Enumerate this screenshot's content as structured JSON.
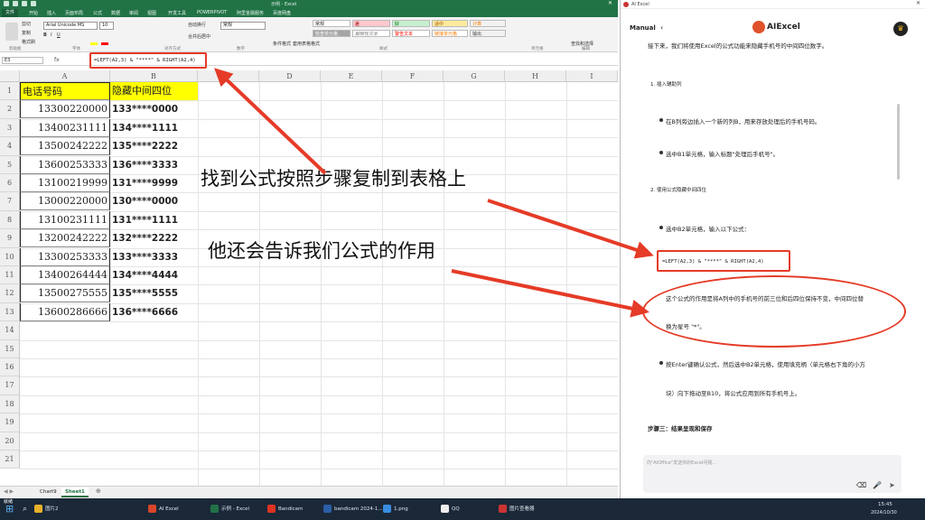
{
  "excel": {
    "window_title": "示例 - Excel",
    "tabs": [
      "文件",
      "开始",
      "插入",
      "页面布局",
      "公式",
      "数据",
      "审阅",
      "视图",
      "开发工具",
      "POWERPIVOT",
      "阿里金融服务",
      "百度网盘"
    ],
    "ribbon": {
      "cut": "剪切",
      "copy": "复制",
      "format_painter": "格式刷",
      "font": "Arial Unicode MS",
      "font_size": "10",
      "wrap": "自动换行",
      "merge": "合并后居中",
      "number_format": "常规",
      "cond_format": "条件格式",
      "table_format": "套用表格格式",
      "styles": [
        "常规",
        "差",
        "好",
        "适中",
        "计算",
        "检查单元格",
        "解释性文本",
        "警告文本",
        "链接单元格",
        "输出"
      ],
      "find_select": "查找和选择",
      "groups": [
        "剪贴板",
        "字体",
        "对齐方式",
        "数字",
        "样式",
        "单元格",
        "编辑"
      ]
    },
    "name_box": "E3",
    "formula_label": "fx",
    "formula": "=LEFT(A2,3) & \"****\" & RIGHT(A2,4)",
    "columns": [
      "A",
      "B",
      "C",
      "D",
      "E",
      "F",
      "G",
      "H",
      "I"
    ],
    "rows": [
      "1",
      "2",
      "3",
      "4",
      "5",
      "6",
      "7",
      "8",
      "9",
      "10",
      "11",
      "12",
      "13",
      "14",
      "15",
      "16",
      "17",
      "18",
      "19",
      "20",
      "21"
    ],
    "header_a": "电话号码",
    "header_b": "隐藏中间四位",
    "data": [
      [
        "13300220000",
        "133****0000"
      ],
      [
        "13400231111",
        "134****1111"
      ],
      [
        "13500242222",
        "135****2222"
      ],
      [
        "13600253333",
        "136****3333"
      ],
      [
        "13100219999",
        "131****9999"
      ],
      [
        "13000220000",
        "130****0000"
      ],
      [
        "13100231111",
        "131****1111"
      ],
      [
        "13200242222",
        "132****2222"
      ],
      [
        "13300253333",
        "133****3333"
      ],
      [
        "13400264444",
        "134****4444"
      ],
      [
        "13500275555",
        "135****5555"
      ],
      [
        "13600286666",
        "136****6666"
      ]
    ],
    "sheets": [
      "Chart9",
      "Sheet1"
    ],
    "status": "就绪",
    "annotation1": "找到公式按照步骤复制到表格上",
    "annotation2": "他还会告诉我们公式的作用"
  },
  "panel": {
    "title": "AI Excel",
    "mode": "Manual",
    "logo": "AIExcel",
    "intro": "接下来，我们将使用Excel的公式功能来隐藏手机号的中间四位数字。",
    "step1": "1. 插入辅助列",
    "b1": "在B列旁边插入一个新的列B，用来存放处理后的手机号码。",
    "b2": "选中B1单元格，输入标题\"处理后手机号\"。",
    "step2": "2. 使用公式隐藏中间四位",
    "b3": "选中B2单元格，输入以下公式：",
    "formula": "=LEFT(A2,3) & \"****\" & RIGHT(A2,4)",
    "explain1": "这个公式的作用是将A列中的手机号的前三位和后四位保持不变，中间四位替",
    "explain2": "换为星号 \"*\"。",
    "b4a": "按Enter键确认公式，然后选中B2单元格，使用填充柄（单元格右下角的小方",
    "b4b": "块）向下拖动至B10，将公式应用到所有手机号上。",
    "step3": "步骤三：结果呈现和保存",
    "placeholder": "向\"AIOffice\"发送你的Excel问题..."
  },
  "taskbar": {
    "items": [
      "图片2",
      "AI Excel",
      "示例 - Excel",
      "Bandicam",
      "bandicam 2024-1...",
      "1.png",
      "QQ",
      "图片查看器"
    ],
    "time": "15:45",
    "date": "2024/10/30"
  },
  "colors": {
    "excel_green": "#217346",
    "highlight": "#ffff00",
    "annotation_red": "#e53b27"
  }
}
